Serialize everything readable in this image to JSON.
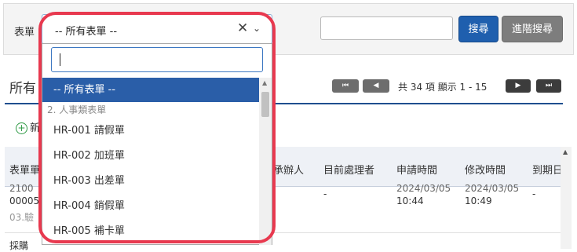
{
  "toolbar": {
    "form_label": "表單",
    "form_select_value": "-- 所有表單 --",
    "clear_glyph": "✕",
    "chevron_glyph": "⌄",
    "search_button": "搜尋",
    "advanced_search_button": "進階搜尋"
  },
  "section": {
    "title": "所有",
    "new_label": "新"
  },
  "pager": {
    "first_glyph": "⏮",
    "prev_glyph": "◀",
    "next_glyph": "▶",
    "last_glyph": "⏭",
    "info": "共 34 項 顯示 1 - 15"
  },
  "table": {
    "headers": [
      "表單單",
      "承辦人",
      "目前處理者",
      "申請時間",
      "修改時間",
      "到期日"
    ],
    "row": {
      "id_line1": "2100",
      "id_line2": "00005",
      "type": "03.驗",
      "handler": "-",
      "submitted_date": "2024/03/05",
      "submitted_time": "10:44",
      "modified_date": "2024/03/05",
      "modified_time": "10:49",
      "due": "-"
    },
    "next_row_start": "採購"
  },
  "dropdown": {
    "search_value": "",
    "items": [
      {
        "label": "-- 所有表單 --",
        "kind": "selected"
      },
      {
        "label": "2. 人事類表單",
        "kind": "group"
      },
      {
        "label": "HR-001 請假單",
        "kind": "option"
      },
      {
        "label": "HR-002 加班單",
        "kind": "option"
      },
      {
        "label": "HR-003 出差單",
        "kind": "option"
      },
      {
        "label": "HR-004 銷假單",
        "kind": "option"
      },
      {
        "label": "HR-005 補卡單",
        "kind": "option"
      }
    ]
  },
  "colors": {
    "primary_button": "#1f5fae",
    "secondary_button": "#7d7d7d",
    "selected_option": "#2a5ea8",
    "highlight_ring": "#e8394f"
  }
}
